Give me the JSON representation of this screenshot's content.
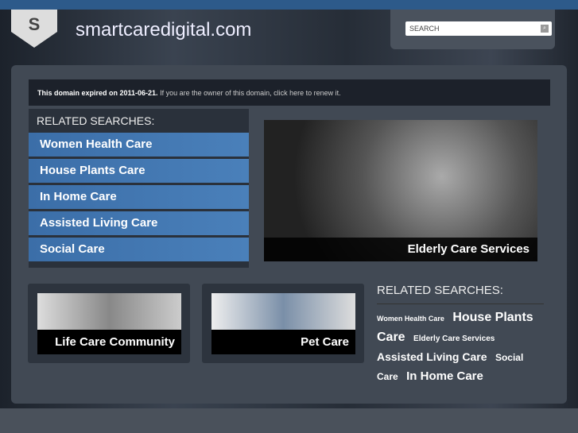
{
  "header": {
    "logo_letter": "S",
    "domain": "smartcaredigital.com",
    "search_placeholder": "SEARCH"
  },
  "notice": {
    "bold": "This domain expired on 2011-06-21.",
    "text": " If you are the owner of this domain, click here to renew it."
  },
  "left": {
    "title": "RELATED SEARCHES:",
    "items": [
      "Women Health Care",
      "House Plants Care",
      "In Home Care",
      "Assisted Living Care",
      "Social Care"
    ]
  },
  "hero": {
    "caption": "Elderly Care Services"
  },
  "cards": [
    "Life Care Community",
    "Pet Care"
  ],
  "right": {
    "title": "RELATED SEARCHES:",
    "tags": [
      {
        "label": "Women Health Care",
        "size": 9
      },
      {
        "label": "House Plants Care",
        "size": 16
      },
      {
        "label": "Elderly Care Services",
        "size": 10
      },
      {
        "label": "Assisted Living Care",
        "size": 14
      },
      {
        "label": "Social Care",
        "size": 12
      },
      {
        "label": "In Home Care",
        "size": 15
      }
    ]
  }
}
